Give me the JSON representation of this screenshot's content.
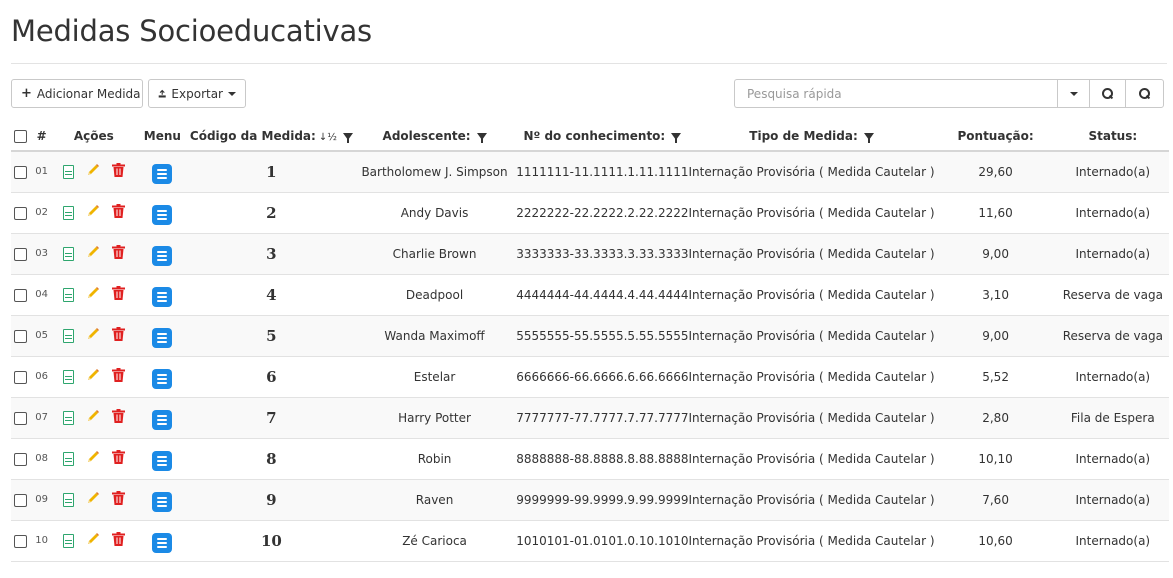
{
  "page": {
    "title": "Medidas Socioeducativas"
  },
  "toolbar": {
    "add_label": "Adicionar Medida",
    "export_label": "Exportar",
    "search_placeholder": "Pesquisa rápida"
  },
  "icons": {
    "add": "plus-icon",
    "export": "export-icon",
    "search": "search-icon",
    "view": "document-icon",
    "edit": "pencil-icon",
    "delete": "trash-icon",
    "menu": "menu-icon"
  },
  "colors": {
    "view_icon": "#2ea66e",
    "edit_icon": "#f0b400",
    "delete_icon": "#e02020",
    "menu_icon": "#1b8ae6"
  },
  "table": {
    "headers": {
      "num": "#",
      "acoes": "Ações",
      "menu": "Menu",
      "codigo": "Código da Medida:",
      "adolescente": "Adolescente:",
      "conhecimento": "Nº do conhecimento:",
      "tipo": "Tipo de Medida:",
      "pontuacao": "Pontuação:",
      "status": "Status:"
    },
    "rows": [
      {
        "num": "01",
        "codigo": "1",
        "adolescente": "Bartholomew J. Simpson",
        "conhecimento": "1111111-11.1111.1.11.1111",
        "tipo": "Internação Provisória ( Medida Cautelar )",
        "pontuacao": "29,60",
        "status": "Internado(a)"
      },
      {
        "num": "02",
        "codigo": "2",
        "adolescente": "Andy Davis",
        "conhecimento": "2222222-22.2222.2.22.2222",
        "tipo": "Internação Provisória ( Medida Cautelar )",
        "pontuacao": "11,60",
        "status": "Internado(a)"
      },
      {
        "num": "03",
        "codigo": "3",
        "adolescente": "Charlie Brown",
        "conhecimento": "3333333-33.3333.3.33.3333",
        "tipo": "Internação Provisória ( Medida Cautelar )",
        "pontuacao": "9,00",
        "status": "Internado(a)"
      },
      {
        "num": "04",
        "codigo": "4",
        "adolescente": "Deadpool",
        "conhecimento": "4444444-44.4444.4.44.4444",
        "tipo": "Internação Provisória ( Medida Cautelar )",
        "pontuacao": "3,10",
        "status": "Reserva de vaga"
      },
      {
        "num": "05",
        "codigo": "5",
        "adolescente": "Wanda Maximoff",
        "conhecimento": "5555555-55.5555.5.55.5555",
        "tipo": "Internação Provisória ( Medida Cautelar )",
        "pontuacao": "9,00",
        "status": "Reserva de vaga"
      },
      {
        "num": "06",
        "codigo": "6",
        "adolescente": "Estelar",
        "conhecimento": "6666666-66.6666.6.66.6666",
        "tipo": "Internação Provisória ( Medida Cautelar )",
        "pontuacao": "5,52",
        "status": "Internado(a)"
      },
      {
        "num": "07",
        "codigo": "7",
        "adolescente": "Harry Potter",
        "conhecimento": "7777777-77.7777.7.77.7777",
        "tipo": "Internação Provisória ( Medida Cautelar )",
        "pontuacao": "2,80",
        "status": "Fila de Espera"
      },
      {
        "num": "08",
        "codigo": "8",
        "adolescente": "Robin",
        "conhecimento": "8888888-88.8888.8.88.8888",
        "tipo": "Internação Provisória ( Medida Cautelar )",
        "pontuacao": "10,10",
        "status": "Internado(a)"
      },
      {
        "num": "09",
        "codigo": "9",
        "adolescente": "Raven",
        "conhecimento": "9999999-99.9999.9.99.9999",
        "tipo": "Internação Provisória ( Medida Cautelar )",
        "pontuacao": "7,60",
        "status": "Internado(a)"
      },
      {
        "num": "10",
        "codigo": "10",
        "adolescente": "Zé Carioca",
        "conhecimento": "1010101-01.0101.0.10.1010",
        "tipo": "Internação Provisória ( Medida Cautelar )",
        "pontuacao": "10,60",
        "status": "Internado(a)"
      }
    ]
  }
}
